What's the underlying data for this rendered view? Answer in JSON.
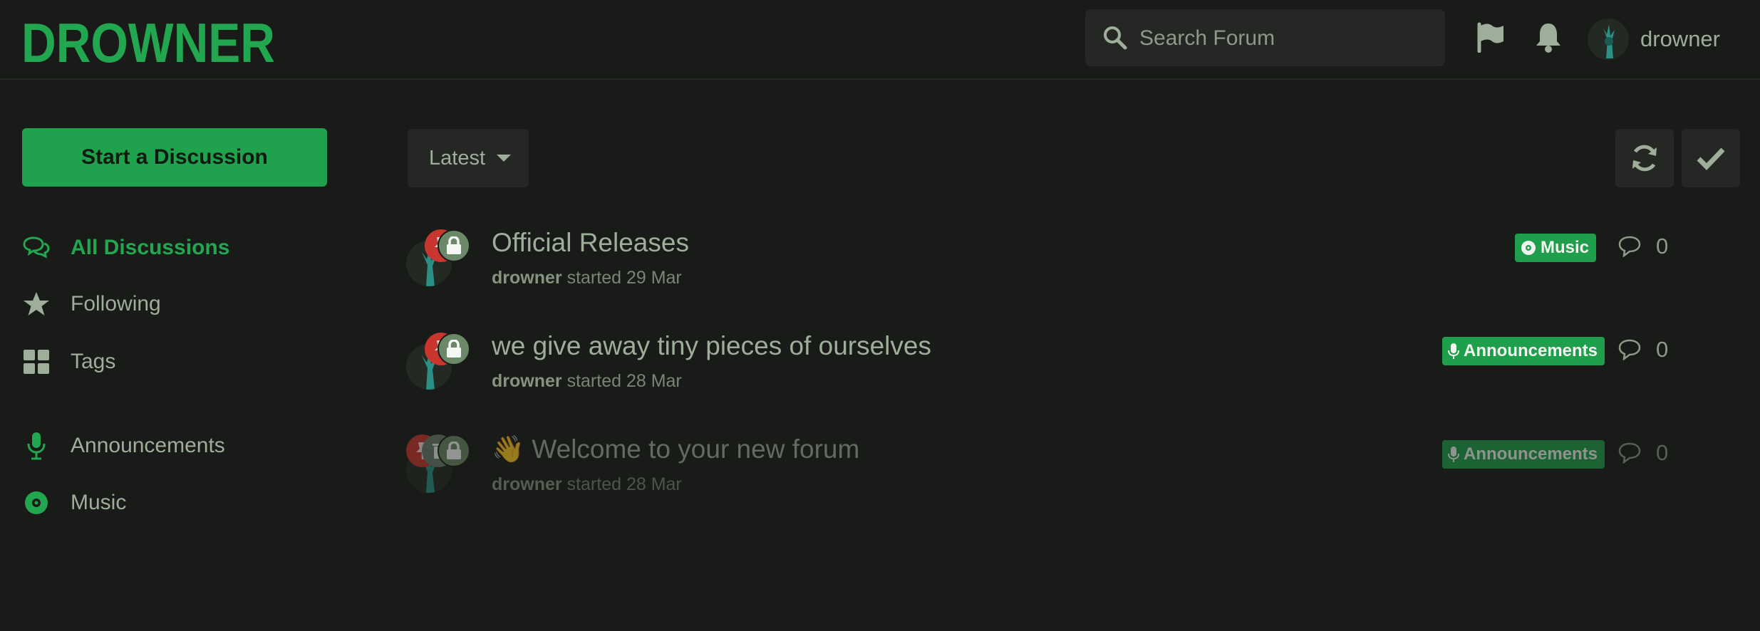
{
  "brand": {
    "logo_text": "DROWNER"
  },
  "header": {
    "search_placeholder": "Search Forum",
    "username": "drowner"
  },
  "sidebar": {
    "start_button": "Start a Discussion",
    "nav": [
      {
        "label": "All Discussions",
        "icon": "comments-icon",
        "active": true
      },
      {
        "label": "Following",
        "icon": "star-icon"
      },
      {
        "label": "Tags",
        "icon": "th-large-icon"
      }
    ],
    "tags": [
      {
        "label": "Announcements",
        "icon": "microphone-icon"
      },
      {
        "label": "Music",
        "icon": "record-icon"
      }
    ]
  },
  "toolbar": {
    "sort_label": "Latest",
    "refresh_icon": "refresh-icon",
    "mark_read_icon": "check-icon"
  },
  "discussions": [
    {
      "title": "Official Releases",
      "author": "drowner",
      "started": "started 29 Mar",
      "tag": "Music",
      "tag_icon": "record-icon",
      "replies": "0"
    },
    {
      "title": "we give away tiny pieces of ourselves",
      "author": "drowner",
      "started": "started 28 Mar",
      "tag": "Announcements",
      "tag_icon": "microphone-icon",
      "replies": "0"
    },
    {
      "title": "Welcome to your new forum",
      "emoji": "👋",
      "author": "drowner",
      "started": "started 28 Mar",
      "tag": "Announcements",
      "tag_icon": "microphone-icon",
      "replies": "0",
      "faded": true
    }
  ],
  "colors": {
    "accent": "#20a14d",
    "background": "#181b17",
    "pin": "#c8362f"
  }
}
